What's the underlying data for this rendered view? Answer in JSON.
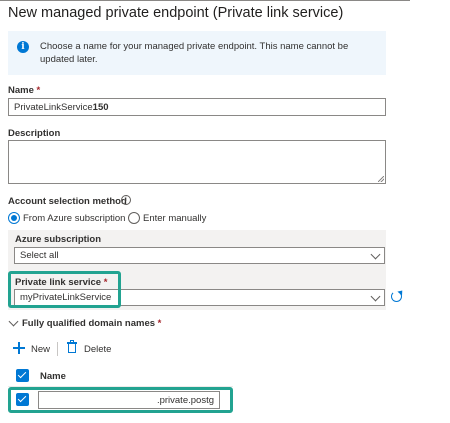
{
  "title": "New managed private endpoint (Private link service)",
  "info": {
    "text": "Choose a name for your managed private endpoint. This name cannot be updated later."
  },
  "name": {
    "label": "Name",
    "required": "*",
    "value_prefix": "PrivateLinkService",
    "value_suffix": "150"
  },
  "description": {
    "label": "Description",
    "value": ""
  },
  "account_selection": {
    "label": "Account selection method",
    "options": [
      "From Azure subscription",
      "Enter manually"
    ],
    "selected": "From Azure subscription"
  },
  "azure_subscription": {
    "label": "Azure subscription",
    "value": "Select all"
  },
  "private_link_service": {
    "label": "Private link service",
    "required": "*",
    "value": "myPrivateLinkService"
  },
  "fqdn": {
    "label": "Fully qualified domain names",
    "required": "*",
    "new_label": "New",
    "delete_label": "Delete",
    "column_header": "Name",
    "rows": [
      {
        "value": ".private.postg",
        "checked": true
      }
    ]
  },
  "colors": {
    "accent": "#0078d4",
    "highlight": "#22a391",
    "required": "#a4262c"
  }
}
